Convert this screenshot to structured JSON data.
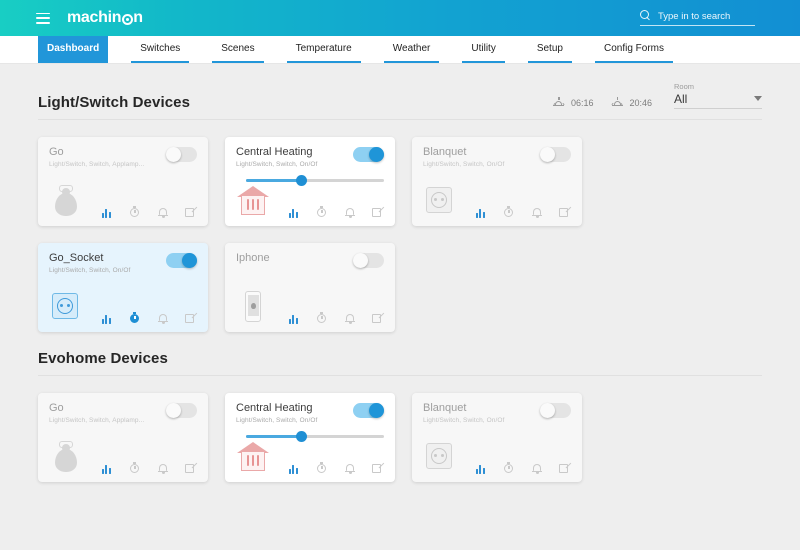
{
  "header": {
    "menu_icon": "hamburger-icon",
    "logo_text_pre": "machin",
    "logo_text_post": "n",
    "logo_ring": "circled-o",
    "search": {
      "icon": "search-icon",
      "placeholder": "Type in to search",
      "value": ""
    }
  },
  "tabs": [
    {
      "label": "Dashboard",
      "active": true
    },
    {
      "label": "Switches",
      "active": false
    },
    {
      "label": "Scenes",
      "active": false
    },
    {
      "label": "Temperature",
      "active": false
    },
    {
      "label": "Weather",
      "active": false
    },
    {
      "label": "Utility",
      "active": false
    },
    {
      "label": "Setup",
      "active": false
    },
    {
      "label": "Config Forms",
      "active": false
    }
  ],
  "sections": [
    {
      "title": "Light/Switch Devices",
      "sunrise": {
        "icon": "sunrise-icon",
        "time": "06:16"
      },
      "sunset": {
        "icon": "sunset-icon",
        "time": "20:46"
      },
      "room_filter": {
        "label": "Room",
        "value": "All",
        "caret": "chevron-down-icon"
      },
      "cards": [
        {
          "name": "Go",
          "subtitle": "Light/Switch, Switch, Applamp...",
          "state": "off",
          "selected": false,
          "glyph": "lamp-icon",
          "slider": null,
          "actions": [
            {
              "icon": "bar-chart-icon",
              "active": true
            },
            {
              "icon": "timer-icon",
              "active": false
            },
            {
              "icon": "bell-icon",
              "active": false
            },
            {
              "icon": "edit-icon",
              "active": false
            }
          ]
        },
        {
          "name": "Central Heating",
          "subtitle": "Light/Switch, Switch, On/Of",
          "state": "on",
          "selected": false,
          "glyph": "heated-house-icon",
          "slider": {
            "value": 40
          },
          "actions": [
            {
              "icon": "bar-chart-icon",
              "active": true
            },
            {
              "icon": "timer-icon",
              "active": false
            },
            {
              "icon": "bell-icon",
              "active": false
            },
            {
              "icon": "edit-icon",
              "active": false
            }
          ]
        },
        {
          "name": "Blanquet",
          "subtitle": "Light/Switch, Switch, On/Of",
          "state": "off",
          "selected": false,
          "glyph": "socket-icon",
          "slider": null,
          "actions": [
            {
              "icon": "bar-chart-icon",
              "active": true
            },
            {
              "icon": "timer-icon",
              "active": false
            },
            {
              "icon": "bell-icon",
              "active": false
            },
            {
              "icon": "edit-icon",
              "active": false
            }
          ]
        },
        {
          "name": "Go_Socket",
          "subtitle": "Light/Switch, Switch, On/Of",
          "state": "on",
          "selected": true,
          "glyph": "socket-icon",
          "slider": null,
          "actions": [
            {
              "icon": "bar-chart-icon",
              "active": true
            },
            {
              "icon": "timer-icon",
              "active": true
            },
            {
              "icon": "bell-icon",
              "active": false
            },
            {
              "icon": "edit-icon",
              "active": false
            }
          ]
        },
        {
          "name": "Iphone",
          "subtitle": "",
          "state": "off",
          "selected": false,
          "glyph": "phone-icon",
          "slider": null,
          "actions": [
            {
              "icon": "bar-chart-icon",
              "active": true
            },
            {
              "icon": "timer-icon",
              "active": false
            },
            {
              "icon": "bell-icon",
              "active": false
            },
            {
              "icon": "edit-icon",
              "active": false
            }
          ]
        }
      ]
    },
    {
      "title": "Evohome Devices",
      "sunrise": null,
      "sunset": null,
      "room_filter": null,
      "cards": [
        {
          "name": "Go",
          "subtitle": "Light/Switch, Switch, Applamp...",
          "state": "off",
          "selected": false,
          "glyph": "lamp-icon",
          "slider": null,
          "actions": [
            {
              "icon": "bar-chart-icon",
              "active": true
            },
            {
              "icon": "timer-icon",
              "active": false
            },
            {
              "icon": "bell-icon",
              "active": false
            },
            {
              "icon": "edit-icon",
              "active": false
            }
          ]
        },
        {
          "name": "Central Heating",
          "subtitle": "Light/Switch, Switch, On/Of",
          "state": "on",
          "selected": false,
          "glyph": "heated-house-icon",
          "slider": {
            "value": 40
          },
          "actions": [
            {
              "icon": "bar-chart-icon",
              "active": true
            },
            {
              "icon": "timer-icon",
              "active": false
            },
            {
              "icon": "bell-icon",
              "active": false
            },
            {
              "icon": "edit-icon",
              "active": false
            }
          ]
        },
        {
          "name": "Blanquet",
          "subtitle": "Light/Switch, Switch, On/Of",
          "state": "off",
          "selected": false,
          "glyph": "socket-icon",
          "slider": null,
          "actions": [
            {
              "icon": "bar-chart-icon",
              "active": true
            },
            {
              "icon": "timer-icon",
              "active": false
            },
            {
              "icon": "bell-icon",
              "active": false
            },
            {
              "icon": "edit-icon",
              "active": false
            }
          ]
        }
      ]
    }
  ],
  "colors": {
    "header_from": "#18cec4",
    "header_to": "#128fd3",
    "accent": "#2196d9",
    "toggle_on": "#1f95d8",
    "card_bg": "#f7f7f7",
    "card_selected_bg": "#e6f4fd",
    "page_bg": "#eeeeee"
  }
}
